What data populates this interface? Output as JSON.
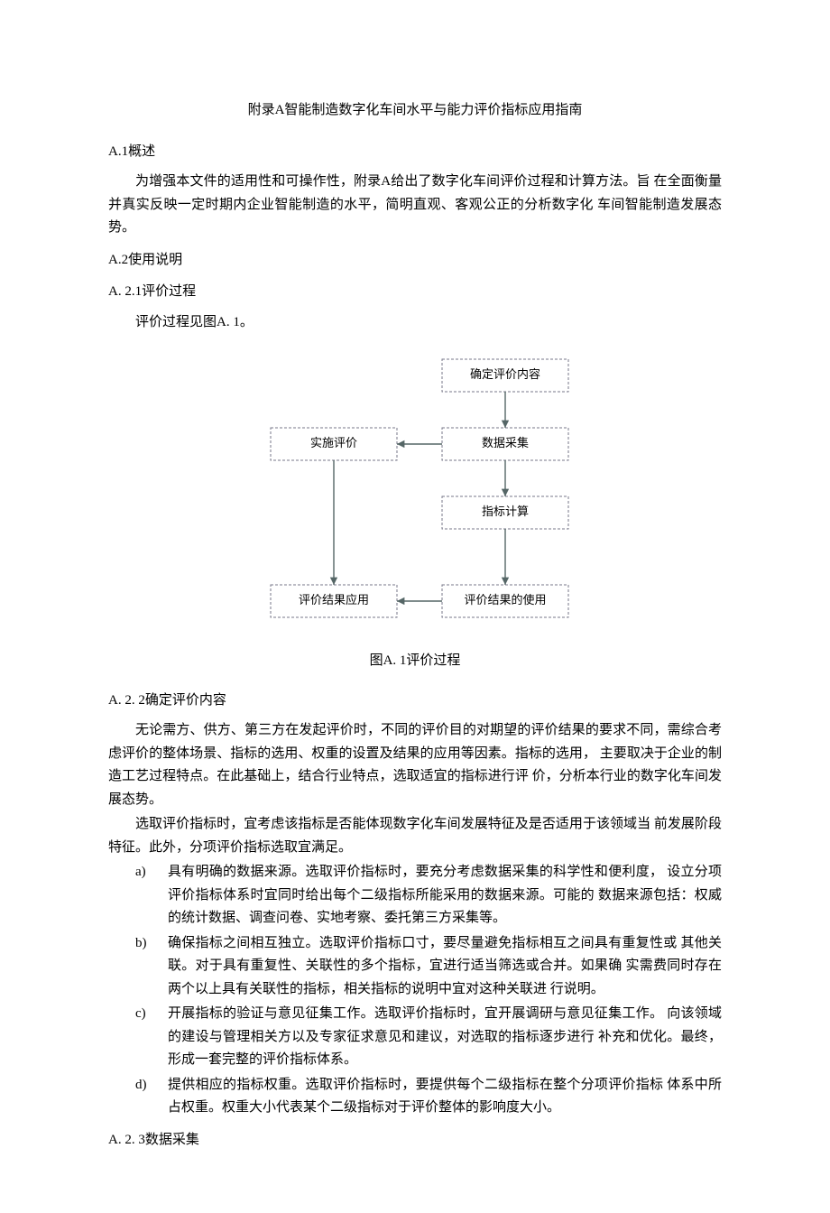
{
  "title": "附录A智能制造数字化车间水平与能力评价指标应用指南",
  "sections": {
    "a1_heading": "A.1概述",
    "a1_body": "为增强本文件的适用性和可操作性，附录A给出了数字化车间评价过程和计算方法。旨 在全面衡量并真实反映一定时期内企业智能制造的水平，简明直观、客观公正的分析数字化 车间智能制造发展态势。",
    "a2_heading": "A.2使用说明",
    "a2_1_heading": "A. 2.1评价过程",
    "a2_1_body": "评价过程见图A. 1。",
    "diagram_caption": "图A. 1评价过程",
    "a2_2_heading": "A. 2. 2确定评价内容",
    "a2_2_p1": "无论需方、供方、第三方在发起评价时，不同的评价目的对期望的评价结果的要求不同，需综合考虑评价的整体场景、指标的选用、权重的设置及结果的应用等因素。指标的选用， 主要取决于企业的制造工艺过程特点。在此基础上，结合行业特点，选取适宜的指标进行评 价，分析本行业的数字化车间发展态势。",
    "a2_2_p2": "选取评价指标时，宜考虑该指标是否能体现数字化车间发展特征及是否适用于该领域当 前发展阶段特征。此外，分项评价指标选取宜满足。",
    "a2_2_list": [
      {
        "marker": "a)",
        "text": "具有明确的数据来源。选取评价指标时，要充分考虑数据采集的科学性和便利度， 设立分项评价指标体系时宜同时给出每个二级指标所能采用的数据来源。可能的 数据来源包括：权威的统计数据、调查问卷、实地考察、委托第三方采集等。"
      },
      {
        "marker": "b)",
        "text": "确保指标之间相互独立。选取评价指标口寸，要尽量避免指标相互之间具有重复性或 其他关联。对于具有重复性、关联性的多个指标，宜进行适当筛选或合并。如果确 实需费同时存在两个以上具有关联性的指标，相关指标的说明中宜对这种关联进 行说明。"
      },
      {
        "marker": "c)",
        "text": "开展指标的验证与意见征集工作。选取评价指标时，宜开展调研与意见征集工作。 向该领域的建设与管理相关方以及专家征求意见和建议，对选取的指标逐步进行 补充和优化。最终，形成一套完整的评价指标体系。"
      },
      {
        "marker": "d)",
        "text": "提供相应的指标权重。选取评价指标时，要提供每个二级指标在整个分项评价指标 体系中所占权重。权重大小代表某个二级指标对于评价整体的影响度大小。"
      }
    ],
    "a2_3_heading": "A. 2. 3数据采集"
  },
  "diagram": {
    "boxes": {
      "b1": "确定评价内容",
      "b2": "实施评价",
      "b3": "数据采集",
      "b4": "指标计算",
      "b5": "评价结果应用",
      "b6": "评价结果的使用"
    }
  }
}
